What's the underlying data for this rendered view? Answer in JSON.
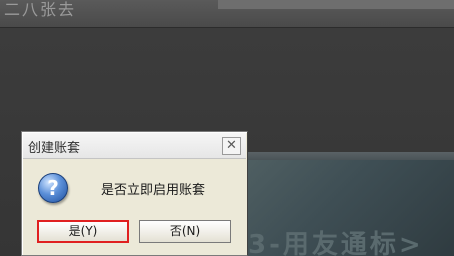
{
  "background": {
    "title_fragment": "二八张去",
    "banner_text": "3-用友通标>"
  },
  "dialog": {
    "title": "创建账套",
    "close_glyph": "✕",
    "icon_glyph": "?",
    "message": "是否立即启用账套",
    "yes_label": "是(Y)",
    "no_label": "否(N)"
  },
  "colors": {
    "dialog_bg": "#ece9d8",
    "highlight_border": "#e02020",
    "icon_blue": "#1e4f9e"
  }
}
